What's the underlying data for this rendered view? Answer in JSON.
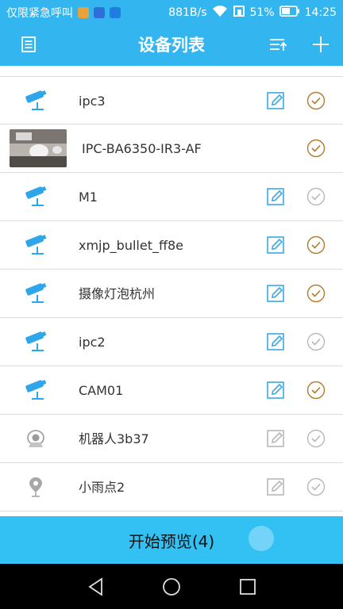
{
  "status_bar": {
    "carrier": "仅限紧急呼叫",
    "speed": "881B/s",
    "battery": "51%",
    "time": "14:25"
  },
  "header": {
    "title": "设备列表",
    "left_icon": "list-icon",
    "sort_icon": "sort-icon",
    "add_icon": "plus-icon"
  },
  "devices": [
    {
      "name": "ipc3",
      "icon": "camera-icon",
      "editable": true,
      "checked": true
    },
    {
      "name": "IPC-BA6350-IR3-AF",
      "icon": "thumbnail",
      "editable": false,
      "checked": true
    },
    {
      "name": "M1",
      "icon": "camera-icon",
      "editable": true,
      "checked": false
    },
    {
      "name": "xmjp_bullet_ff8e",
      "icon": "camera-icon",
      "editable": true,
      "checked": true
    },
    {
      "name": "摄像灯泡杭州",
      "icon": "camera-icon",
      "editable": true,
      "checked": true
    },
    {
      "name": "ipc2",
      "icon": "camera-icon",
      "editable": true,
      "checked": false
    },
    {
      "name": "CAM01",
      "icon": "camera-icon",
      "editable": true,
      "checked": true
    },
    {
      "name": "机器人3b37",
      "icon": "robot-icon",
      "editable": false,
      "checked": false
    },
    {
      "name": "小雨点2",
      "icon": "location-icon",
      "editable": false,
      "checked": false
    }
  ],
  "footer": {
    "button_label": "开始预览(4)"
  },
  "colors": {
    "accent": "#33b6f0",
    "footer": "#33c1f4",
    "check_active": "#b07a2a",
    "check_inactive": "#b8b8b8",
    "edit_active": "#39a9e6",
    "edit_inactive": "#b8b8b8"
  }
}
